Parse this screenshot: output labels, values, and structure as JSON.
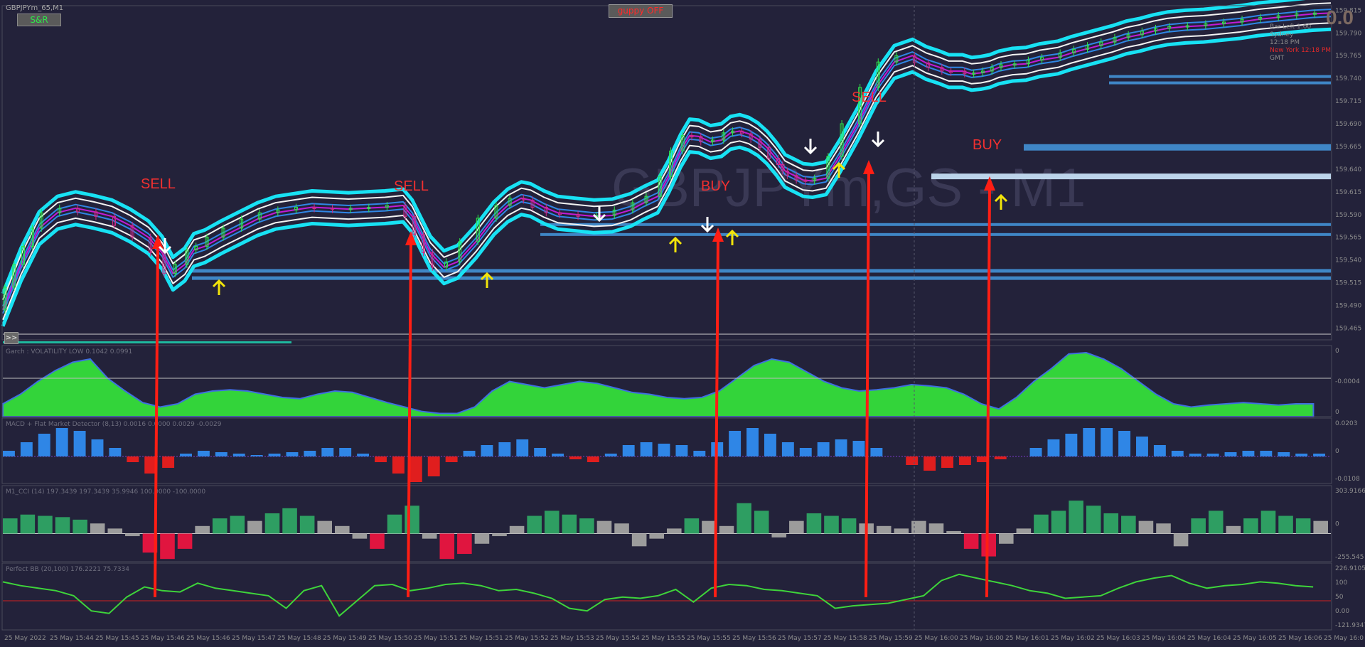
{
  "header": {
    "symbol_label": "GBPJPYm_65,M1",
    "watermark": "GBPJPYm,GS - M1",
    "big_counter": "0.0",
    "sr_button": "S&R",
    "guppy_button": "guppy OFF",
    "expand_button": ">>",
    "info_lines": [
      {
        "text": "Bar Left  1:00",
        "color": "#8a8a8a"
      },
      {
        "text": "Sydney",
        "color": "#8a8a8a"
      },
      {
        "text": "12:18 PM",
        "color": "#8a8a8a"
      },
      {
        "text": "New York  12:18 PM",
        "color": "#e02a2a"
      },
      {
        "text": "GMT",
        "color": "#8a8a8a"
      }
    ]
  },
  "colors": {
    "background": "#23223a",
    "up_arrow": "#f2e40a",
    "down_arrow": "#ffffff",
    "signal_line": "#ff1e14",
    "bb_outer": "#18e2f4",
    "bb_inner": "#f2f2f2",
    "ma_magenta": "#c21ad8",
    "ma_blue": "#2f86e6",
    "histogram_green": "#33d43a",
    "macd_blue": "#2f86e6",
    "macd_red": "#e01e1e",
    "cci_green": "#2e9e62",
    "cci_red": "#e0153f",
    "cci_gray": "#9c9c9c",
    "sr_line": "#3f86c6",
    "annotation_red": "#f23030"
  },
  "annotations": [
    {
      "label": "SELL",
      "type": "sell"
    },
    {
      "label": "SELL",
      "type": "sell"
    },
    {
      "label": "BUY",
      "type": "buy"
    },
    {
      "label": "SELL",
      "type": "sell"
    },
    {
      "label": "BUY",
      "type": "buy"
    }
  ],
  "chart_data": {
    "type": "line",
    "price_axis": {
      "ticks": [
        "159.815",
        "159.790",
        "159.765",
        "159.740",
        "159.715",
        "159.690",
        "159.665",
        "159.640",
        "159.615",
        "159.590",
        "159.565",
        "159.540",
        "159.515",
        "159.490",
        "159.465"
      ],
      "ylim": [
        159.452,
        159.82
      ]
    },
    "time_axis": {
      "ticks": [
        "25 May 2022",
        "25 May 15:44",
        "25 May 15:45",
        "25 May 15:46",
        "25 May 15:46",
        "25 May 15:47",
        "25 May 15:48",
        "25 May 15:49",
        "25 May 15:50",
        "25 May 15:51",
        "25 May 15:51",
        "25 May 15:52",
        "25 May 15:53",
        "25 May 15:54",
        "25 May 15:55",
        "25 May 15:55",
        "25 May 15:56",
        "25 May 15:57",
        "25 May 15:58",
        "25 May 15:59",
        "25 May 16:00",
        "25 May 16:00",
        "25 May 16:01",
        "25 May 16:02",
        "25 May 16:03",
        "25 May 16:04",
        "25 May 16:04",
        "25 May 16:05",
        "25 May 16:06",
        "25 May 16:0"
      ]
    },
    "price_series": {
      "name": "GBPJPYm_65,M1",
      "x": [
        0,
        10,
        20,
        30,
        40,
        60,
        80,
        100,
        120,
        140,
        160,
        175,
        187,
        200,
        210,
        222,
        240,
        260,
        280,
        300,
        320,
        340,
        360,
        380,
        400,
        420,
        440,
        450,
        460,
        470,
        485,
        500,
        520,
        540,
        555,
        570,
        580,
        595,
        610,
        630,
        650,
        670,
        690,
        705,
        720,
        732,
        745,
        755,
        765,
        778,
        790,
        800,
        810,
        820,
        830,
        840,
        850,
        855,
        860,
        870,
        880,
        890,
        905,
        920,
        940,
        960,
        980,
        1000,
        1015,
        1030,
        1040,
        1055,
        1065,
        1075,
        1085,
        1095,
        1110,
        1125,
        1140,
        1160,
        1175,
        1190,
        1205,
        1220,
        1235,
        1250,
        1265,
        1280,
        1300,
        1320,
        1340,
        1360,
        1380,
        1400,
        1420,
        1440,
        1460
      ],
      "y": [
        159.485,
        159.51,
        159.535,
        159.555,
        159.575,
        159.592,
        159.597,
        159.593,
        159.588,
        159.578,
        159.565,
        159.548,
        159.525,
        159.535,
        159.551,
        159.555,
        159.565,
        159.575,
        159.585,
        159.592,
        159.595,
        159.598,
        159.597,
        159.596,
        159.597,
        159.598,
        159.6,
        159.588,
        159.568,
        159.548,
        159.532,
        159.538,
        159.56,
        159.586,
        159.6,
        159.608,
        159.606,
        159.598,
        159.592,
        159.59,
        159.588,
        159.589,
        159.595,
        159.603,
        159.61,
        159.632,
        159.66,
        159.677,
        159.676,
        159.67,
        159.672,
        159.68,
        159.682,
        159.679,
        159.673,
        159.664,
        159.652,
        159.645,
        159.638,
        159.633,
        159.628,
        159.627,
        159.63,
        159.654,
        159.69,
        159.73,
        159.758,
        159.765,
        159.757,
        159.752,
        159.748,
        159.748,
        159.745,
        159.746,
        159.748,
        159.752,
        159.755,
        159.756,
        159.76,
        159.763,
        159.768,
        159.772,
        159.776,
        159.78,
        159.785,
        159.788,
        159.792,
        159.795,
        159.797,
        159.798,
        159.8,
        159.802,
        159.805,
        159.807,
        159.809,
        159.811,
        159.812
      ]
    },
    "support_resistance_levels": [
      159.664,
      159.632,
      159.579,
      159.568,
      159.528,
      159.52,
      159.742,
      159.735
    ],
    "signals": [
      {
        "label": "SELL",
        "x_index": 5
      },
      {
        "label": "SELL",
        "x_index": 23
      },
      {
        "label": "BUY",
        "x_index": 45
      },
      {
        "label": "SELL",
        "x_index": 58
      },
      {
        "label": "BUY",
        "x_index": 66
      }
    ],
    "panels": [
      {
        "name": "Garch",
        "title": "Garch : VOLATILITY LOW 0.1042 0.0991",
        "ticks": [
          "0",
          "-0.0004",
          "0"
        ],
        "values": [
          0.2,
          0.35,
          0.55,
          0.72,
          0.85,
          0.9,
          0.6,
          0.4,
          0.22,
          0.15,
          0.2,
          0.35,
          0.4,
          0.42,
          0.4,
          0.35,
          0.3,
          0.28,
          0.35,
          0.4,
          0.38,
          0.3,
          0.22,
          0.15,
          0.08,
          0.05,
          0.05,
          0.15,
          0.4,
          0.55,
          0.5,
          0.45,
          0.5,
          0.55,
          0.52,
          0.45,
          0.38,
          0.35,
          0.3,
          0.28,
          0.3,
          0.4,
          0.6,
          0.8,
          0.9,
          0.85,
          0.7,
          0.55,
          0.45,
          0.4,
          0.42,
          0.45,
          0.5,
          0.48,
          0.45,
          0.35,
          0.2,
          0.12,
          0.3,
          0.55,
          0.75,
          0.98,
          1.0,
          0.9,
          0.75,
          0.55,
          0.35,
          0.2,
          0.15,
          0.18,
          0.2,
          0.22,
          0.2,
          0.18,
          0.2,
          0.2
        ]
      },
      {
        "name": "MACD",
        "title": "MACD + Flat Market Detector (8,13) 0.0016 0.0000 0.0029 -0.0029",
        "ticks": [
          "0.0203",
          "0",
          "-0.0108"
        ],
        "values": [
          0.2,
          0.5,
          0.8,
          1.0,
          0.9,
          0.6,
          0.3,
          -0.2,
          -0.6,
          -0.4,
          0.1,
          0.2,
          0.15,
          0.1,
          0.05,
          0.1,
          0.15,
          0.2,
          0.3,
          0.3,
          0.1,
          -0.2,
          -0.6,
          -0.9,
          -0.7,
          -0.2,
          0.2,
          0.4,
          0.5,
          0.6,
          0.3,
          0.1,
          -0.1,
          -0.2,
          0.1,
          0.4,
          0.5,
          0.45,
          0.4,
          0.2,
          0.5,
          0.9,
          1.0,
          0.8,
          0.5,
          0.3,
          0.5,
          0.6,
          0.55,
          0.3,
          0.0,
          -0.3,
          -0.5,
          -0.4,
          -0.3,
          -0.2,
          -0.1,
          0.0,
          0.3,
          0.6,
          0.8,
          1.0,
          1.0,
          0.9,
          0.7,
          0.4,
          0.2,
          0.1,
          0.1,
          0.15,
          0.2,
          0.2,
          0.15,
          0.1,
          0.1
        ]
      },
      {
        "name": "CCI",
        "title": "M1_CCI (14) 197.3439 197.3439 35.9946 100.0000 -100.0000",
        "ticks": [
          "303.9166",
          "0",
          "-255.545"
        ],
        "values": [
          120,
          150,
          140,
          130,
          110,
          80,
          40,
          -20,
          -150,
          -200,
          -120,
          60,
          120,
          140,
          100,
          160,
          200,
          140,
          100,
          60,
          -40,
          -120,
          150,
          220,
          -40,
          -200,
          -160,
          -80,
          -20,
          60,
          140,
          180,
          150,
          120,
          100,
          80,
          -100,
          -40,
          40,
          120,
          100,
          60,
          240,
          180,
          -30,
          100,
          160,
          140,
          120,
          80,
          60,
          40,
          100,
          80,
          20,
          -120,
          -180,
          -80,
          40,
          150,
          180,
          260,
          220,
          160,
          140,
          100,
          80,
          -100,
          120,
          180,
          60,
          120,
          180,
          140,
          120,
          100
        ]
      },
      {
        "name": "Perfect BB",
        "title": "Perfect BB (20,100) 176.2221 75.7334",
        "ticks": [
          "226.9105",
          "100",
          "50",
          "0.00",
          "-121.9347"
        ],
        "values": [
          150,
          120,
          100,
          80,
          40,
          -80,
          -100,
          30,
          110,
          80,
          70,
          140,
          100,
          80,
          60,
          40,
          -60,
          80,
          120,
          -120,
          0,
          120,
          130,
          80,
          100,
          130,
          140,
          120,
          80,
          90,
          60,
          20,
          -60,
          -80,
          10,
          30,
          20,
          40,
          90,
          -10,
          100,
          130,
          120,
          90,
          80,
          60,
          40,
          -60,
          -40,
          -30,
          -20,
          10,
          40,
          160,
          210,
          180,
          150,
          120,
          80,
          60,
          20,
          30,
          40,
          100,
          150,
          180,
          200,
          140,
          100,
          120,
          130,
          150,
          140,
          120,
          110
        ]
      }
    ]
  }
}
